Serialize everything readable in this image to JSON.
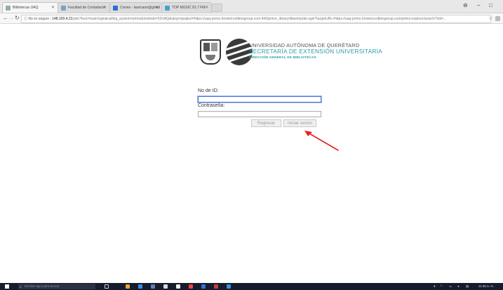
{
  "browser": {
    "tabs": [
      {
        "label": "Bibliotecas UAQ",
        "active": true
      },
      {
        "label": "Facultad de Contaduría",
        "active": false
      },
      {
        "label": "Correo - lauricaon@gmail",
        "active": false
      },
      {
        "label": "TOP MUSIC 91.7 FM",
        "active": false
      }
    ],
    "address": {
      "security": "No es seguro",
      "host": "148.220.4.21",
      "path": "/pds?func=load-login&calling_system=primo&institute=52UAQ&lang=spa&url=https://uaq-primo.hosted.exlibrisgroup.com:443/primo_library/libweb/pdsLogin?targetURL=https://uaq-primo.hosted.exlibrisgroup.com/primo-explore/search?vid=..."
    }
  },
  "header": {
    "university": "UNIVERSIDAD AUTÓNOMA DE QUERÉTARO",
    "secretariat": "SECRETARÍA DE EXTENSIÓN UNIVERSITARIA",
    "direction": "DIRECCIÓN GENERAL DE BIBLIOTECAS"
  },
  "login": {
    "id_label": "No de ID:",
    "id_value": "",
    "password_label": "Contraseña:",
    "password_value": "",
    "back_button": "Regresar",
    "login_button": "Iniciar sesión"
  },
  "annotation": {
    "color": "#e8201f"
  },
  "taskbar": {
    "search_placeholder": "Escribe aquí para buscar",
    "time": "11:36 a. m."
  }
}
